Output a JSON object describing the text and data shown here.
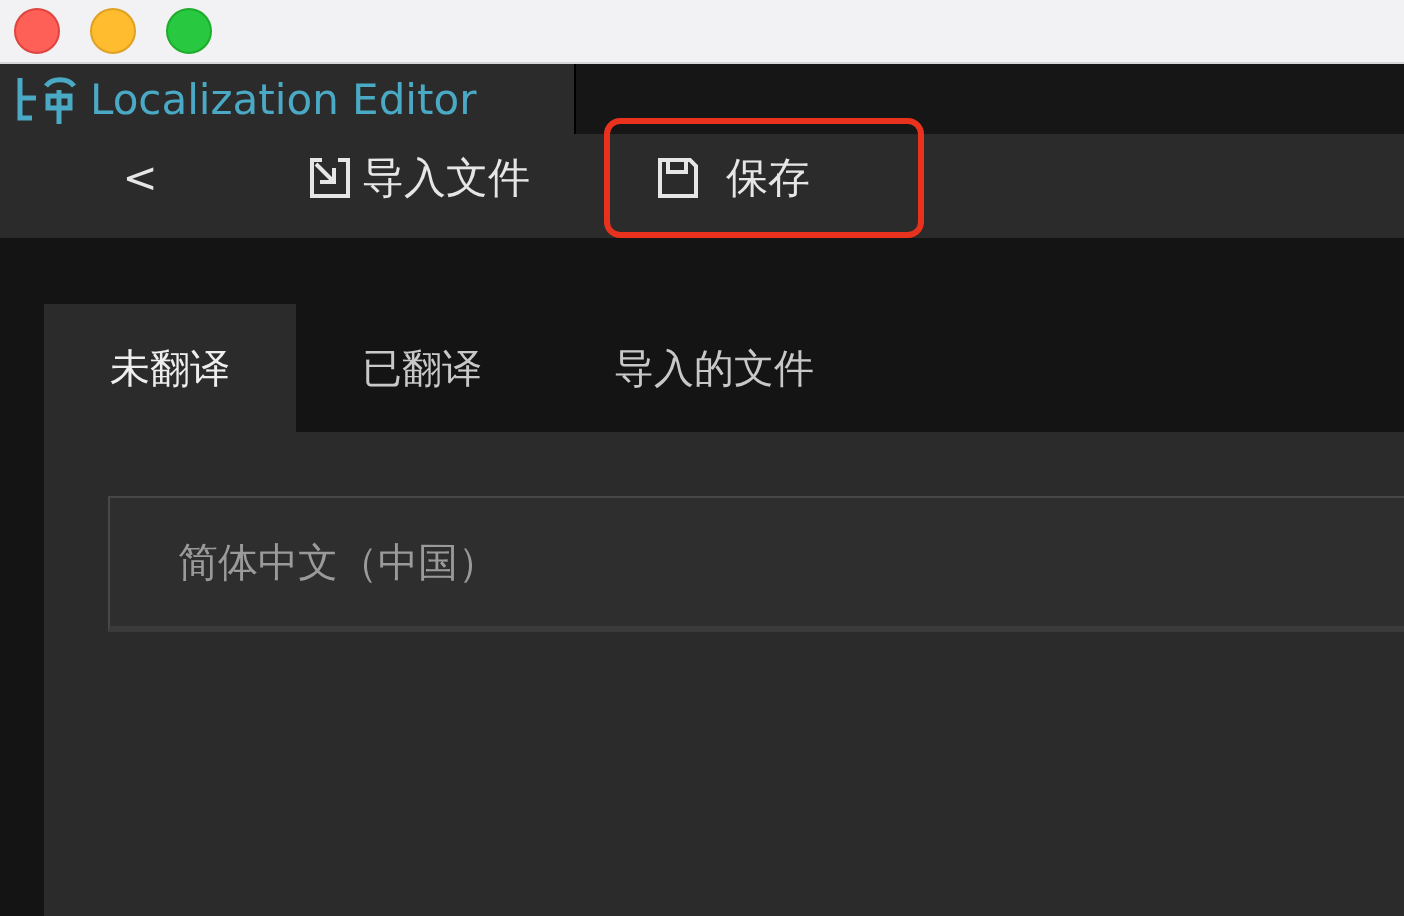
{
  "window": {
    "title": "Localization Editor"
  },
  "toolbar": {
    "items": [
      {
        "kind": "back",
        "label": "<",
        "highlighted": false
      },
      {
        "kind": "import",
        "label": "导入文件",
        "highlighted": false
      },
      {
        "kind": "save",
        "label": "保存",
        "highlighted": true
      }
    ]
  },
  "tabs": [
    {
      "label": "未翻译",
      "selected": true
    },
    {
      "label": "已翻译",
      "selected": false
    },
    {
      "label": "导入的文件",
      "selected": false
    }
  ],
  "language_select": {
    "value": "简体中文（中国）"
  }
}
